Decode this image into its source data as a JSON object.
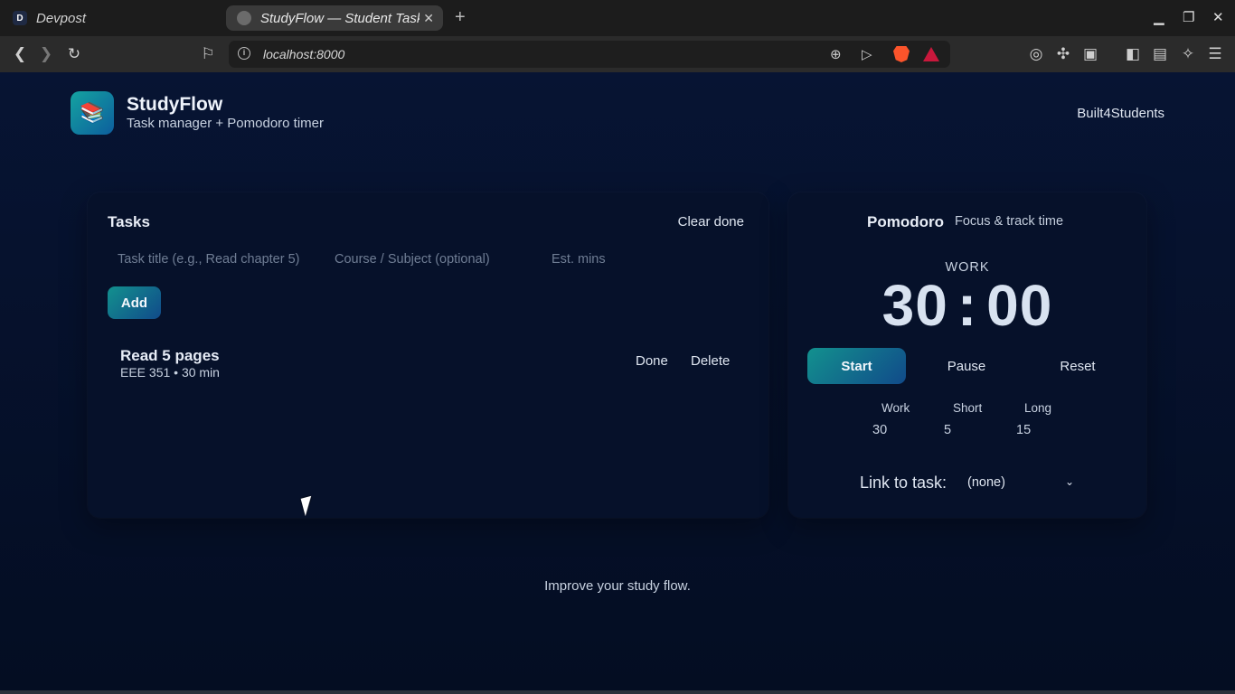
{
  "browser": {
    "tabs": [
      {
        "label": "Devpost",
        "favicon": "D"
      },
      {
        "label": "StudyFlow — Student Task Manager",
        "favicon": "globe-icon"
      }
    ],
    "url": "localhost:8000"
  },
  "header": {
    "title": "StudyFlow",
    "subtitle": "Task manager + Pomodoro timer",
    "right_label": "Built4Students"
  },
  "tasks": {
    "title": "Tasks",
    "clear_done": "Clear done",
    "title_placeholder": "Task title (e.g., Read chapter 5)",
    "course_placeholder": "Course / Subject (optional)",
    "mins_placeholder": "Est. mins",
    "add_label": "Add",
    "items": [
      {
        "title": "Read 5 pages",
        "meta": "EEE 351 • 30 min",
        "done_label": "Done",
        "delete_label": "Delete"
      }
    ]
  },
  "pomodoro": {
    "title": "Pomodoro",
    "subtitle": "Focus & track time",
    "mode": "WORK",
    "minutes": "30",
    "seconds": "00",
    "start_label": "Start",
    "pause_label": "Pause",
    "reset_label": "Reset",
    "durations": {
      "work_label": "Work",
      "work_value": "30",
      "short_label": "Short",
      "short_value": "5",
      "long_label": "Long",
      "long_value": "15"
    },
    "link_label": "Link to task:",
    "link_value": "(none)"
  },
  "footer": "Improve your study flow.",
  "colors": {
    "background": "#06112a",
    "accent_start": "#12918e",
    "accent_end": "#114a8a"
  }
}
